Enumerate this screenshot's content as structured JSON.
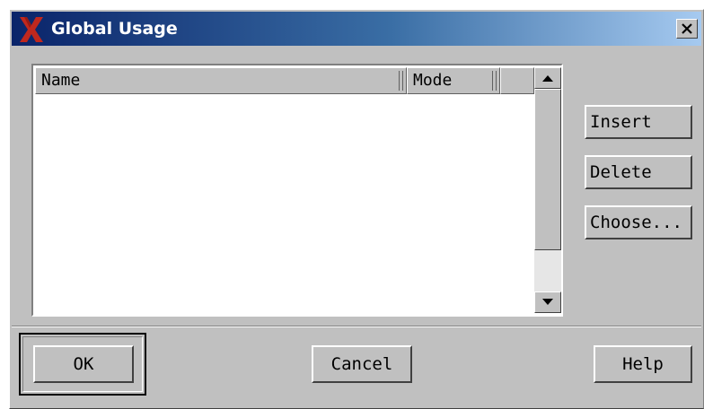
{
  "window": {
    "title": "Global Usage",
    "icon": "x-app-icon",
    "close_icon": "close-icon"
  },
  "list": {
    "columns": [
      "Name",
      "Mode",
      ""
    ],
    "rows": []
  },
  "side_buttons": {
    "insert": "Insert",
    "delete": "Delete",
    "choose": "Choose..."
  },
  "bottom_buttons": {
    "ok": "OK",
    "cancel": "Cancel",
    "help": "Help"
  },
  "colors": {
    "title_gradient_start": "#0a246a",
    "title_gradient_end": "#a6caf0",
    "dialog_bg": "#c0c0c0",
    "icon_red": "#c0281e"
  }
}
